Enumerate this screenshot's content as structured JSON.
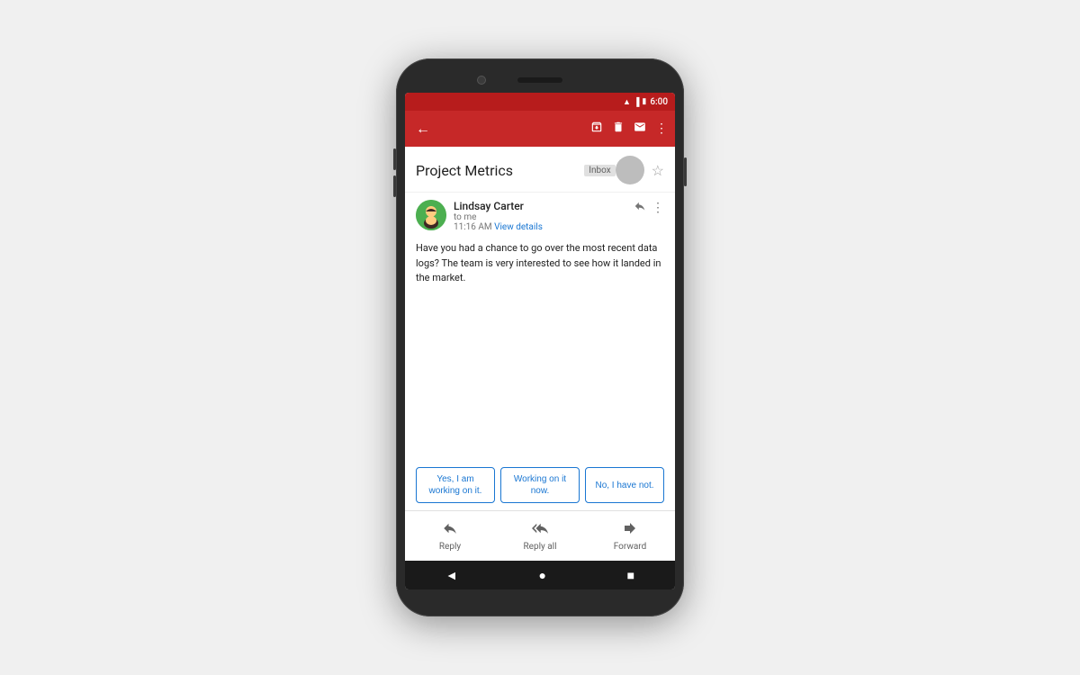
{
  "statusBar": {
    "time": "6:00",
    "icons": [
      "wifi",
      "signal",
      "battery"
    ]
  },
  "appBar": {
    "backLabel": "←",
    "icons": [
      "archive",
      "delete",
      "mail",
      "more"
    ]
  },
  "emailHeader": {
    "subject": "Project Metrics",
    "badge": "Inbox"
  },
  "email": {
    "senderName": "Lindsay Carter",
    "to": "to me",
    "time": "11:16 AM",
    "viewDetails": "View details",
    "body": "Have you had a chance to go over the most recent data logs? The team is very interested to see how it landed in the market."
  },
  "smartReplies": [
    "Yes, I am working on it.",
    "Working on it now.",
    "No, I have not."
  ],
  "bottomActions": {
    "reply": "Reply",
    "replyAll": "Reply all",
    "forward": "Forward"
  },
  "androidNav": {
    "back": "◄",
    "home": "●",
    "recents": "■"
  }
}
